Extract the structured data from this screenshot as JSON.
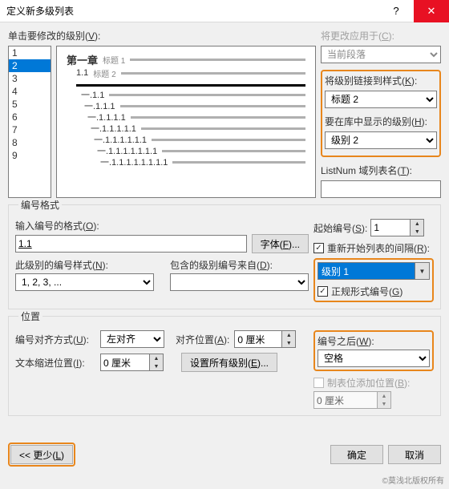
{
  "title": "定义新多级列表",
  "help_icon": "?",
  "close_icon": "✕",
  "top_left_label": "单击要修改的级别(V):",
  "apply_label": "将更改应用于(C):",
  "apply_value": "当前段落",
  "levels": [
    "1",
    "2",
    "3",
    "4",
    "5",
    "6",
    "7",
    "8",
    "9"
  ],
  "selected_level": "2",
  "preview": {
    "r1_num": "第一章",
    "r1_h": "标题 1",
    "r2_num": "1.1",
    "r2_h": "标题 2",
    "rows": [
      "一.1.1",
      "一.1.1.1",
      "一.1.1.1.1",
      "一.1.1.1.1.1",
      "一.1.1.1.1.1.1",
      "一.1.1.1.1.1.1.1",
      "一.1.1.1.1.1.1.1.1"
    ]
  },
  "link_style_label": "将级别链接到样式(K):",
  "link_style_value": "标题 2",
  "show_in_lib_label": "要在库中显示的级别(H):",
  "show_in_lib_value": "级别 2",
  "listnum_label": "ListNum 域列表名(T):",
  "listnum_value": "",
  "numfmt_group": "编号格式",
  "enter_fmt_label": "输入编号的格式(O):",
  "enter_fmt_value": "1.1",
  "font_btn": "字体(F)...",
  "start_at_label": "起始编号(S):",
  "start_at_value": "1",
  "restart_label": "重新开始列表的间隔(R):",
  "restart_value": "级别 1",
  "level_style_label": "此级别的编号样式(N):",
  "level_style_value": "1, 2, 3, ...",
  "include_from_label": "包含的级别编号来自(D):",
  "include_from_value": "",
  "legal_label": "正规形式编号(G)",
  "pos_group": "位置",
  "align_label": "编号对齐方式(U):",
  "align_value": "左对齐",
  "align_at_label": "对齐位置(A):",
  "align_at_value": "0 厘米",
  "after_num_label": "编号之后(W):",
  "after_num_value": "空格",
  "indent_label": "文本缩进位置(I):",
  "indent_value": "0 厘米",
  "set_all_btn": "设置所有级别(E)...",
  "tab_add_label": "制表位添加位置(B):",
  "tab_add_value": "0 厘米",
  "less_btn": "<< 更少(L)",
  "ok_btn": "确定",
  "cancel_btn": "取消",
  "watermark": "©莫浅北版权所有"
}
